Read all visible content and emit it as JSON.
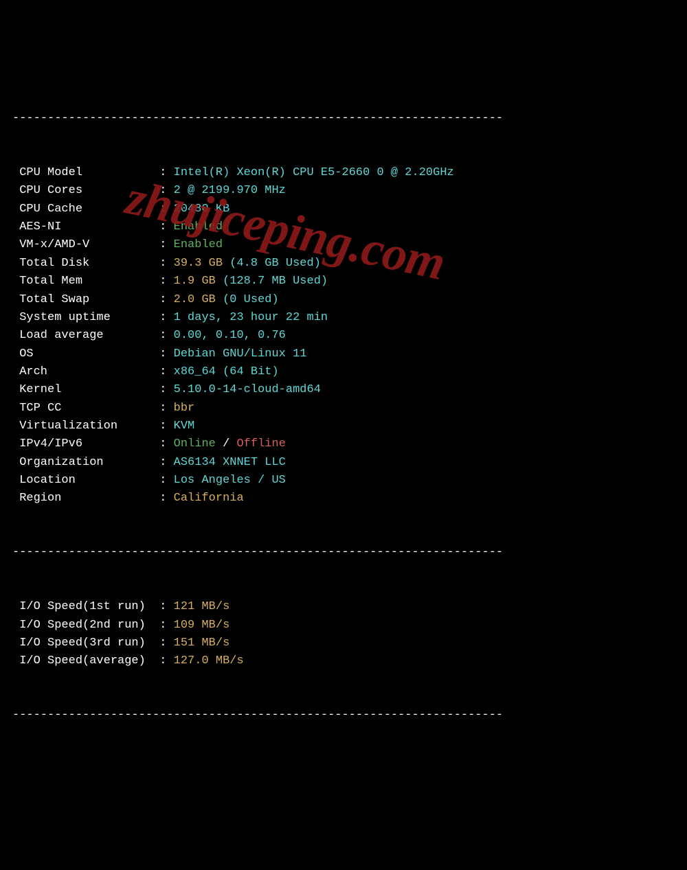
{
  "divider": "----------------------------------------------------------------------",
  "rows_top": [
    {
      "label": "CPU Model",
      "parts": [
        {
          "text": "Intel(R) Xeon(R) CPU E5-2660 0 @ 2.20GHz",
          "cls": "cyan"
        }
      ]
    },
    {
      "label": "CPU Cores",
      "parts": [
        {
          "text": "2 @ 2199.970 MHz",
          "cls": "cyan"
        }
      ]
    },
    {
      "label": "CPU Cache",
      "parts": [
        {
          "text": "20480 KB",
          "cls": "cyan"
        }
      ]
    },
    {
      "label": "AES-NI",
      "parts": [
        {
          "text": "Enabled",
          "cls": "green"
        }
      ]
    },
    {
      "label": "VM-x/AMD-V",
      "parts": [
        {
          "text": "Enabled",
          "cls": "green"
        }
      ]
    },
    {
      "label": "Total Disk",
      "parts": [
        {
          "text": "39.3 GB ",
          "cls": "yellow"
        },
        {
          "text": "(4.8 GB Used)",
          "cls": "cyan"
        }
      ]
    },
    {
      "label": "Total Mem",
      "parts": [
        {
          "text": "1.9 GB ",
          "cls": "yellow"
        },
        {
          "text": "(128.7 MB Used)",
          "cls": "cyan"
        }
      ]
    },
    {
      "label": "Total Swap",
      "parts": [
        {
          "text": "2.0 GB ",
          "cls": "yellow"
        },
        {
          "text": "(0 Used)",
          "cls": "cyan"
        }
      ]
    },
    {
      "label": "System uptime",
      "parts": [
        {
          "text": "1 days, 23 hour 22 min",
          "cls": "cyan"
        }
      ]
    },
    {
      "label": "Load average",
      "parts": [
        {
          "text": "0.00, 0.10, 0.76",
          "cls": "cyan"
        }
      ]
    },
    {
      "label": "OS",
      "parts": [
        {
          "text": "Debian GNU/Linux 11",
          "cls": "cyan"
        }
      ]
    },
    {
      "label": "Arch",
      "parts": [
        {
          "text": "x86_64 (64 Bit)",
          "cls": "cyan"
        }
      ]
    },
    {
      "label": "Kernel",
      "parts": [
        {
          "text": "5.10.0-14-cloud-amd64",
          "cls": "cyan"
        }
      ]
    },
    {
      "label": "TCP CC",
      "parts": [
        {
          "text": "bbr",
          "cls": "yellow"
        }
      ]
    },
    {
      "label": "Virtualization",
      "parts": [
        {
          "text": "KVM",
          "cls": "cyan"
        }
      ]
    },
    {
      "label": "IPv4/IPv6",
      "parts": [
        {
          "text": "Online",
          "cls": "green"
        },
        {
          "text": " / ",
          "cls": "white"
        },
        {
          "text": "Offline",
          "cls": "red"
        }
      ]
    },
    {
      "label": "Organization",
      "parts": [
        {
          "text": "AS6134 XNNET LLC",
          "cls": "cyan"
        }
      ]
    },
    {
      "label": "Location",
      "parts": [
        {
          "text": "Los Angeles / US",
          "cls": "cyan"
        }
      ]
    },
    {
      "label": "Region",
      "parts": [
        {
          "text": "California",
          "cls": "yellow"
        }
      ]
    }
  ],
  "rows_io": [
    {
      "label": "I/O Speed(1st run)",
      "parts": [
        {
          "text": "121 MB/s",
          "cls": "yellow"
        }
      ]
    },
    {
      "label": "I/O Speed(2nd run)",
      "parts": [
        {
          "text": "109 MB/s",
          "cls": "yellow"
        }
      ]
    },
    {
      "label": "I/O Speed(3rd run)",
      "parts": [
        {
          "text": "151 MB/s",
          "cls": "yellow"
        }
      ]
    },
    {
      "label": "I/O Speed(average)",
      "parts": [
        {
          "text": "127.0 MB/s",
          "cls": "yellow"
        }
      ]
    }
  ],
  "watermark": "zhujiceping.com"
}
